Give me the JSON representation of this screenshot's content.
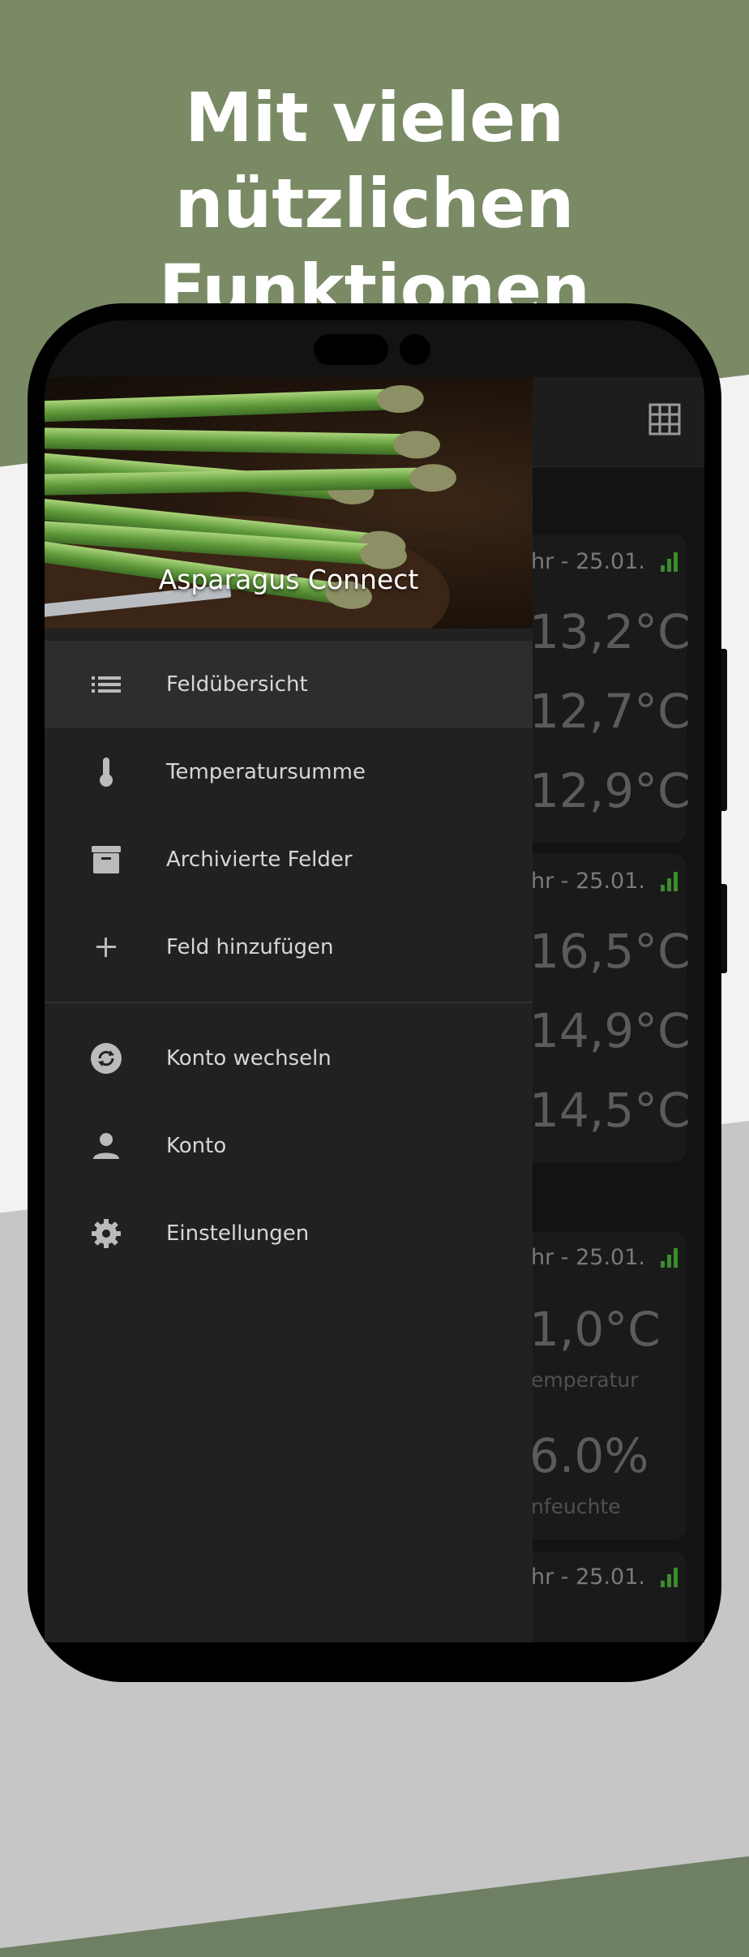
{
  "headline": {
    "line1": "Mit vielen nützlichen",
    "line2": "Funktionen"
  },
  "drawer": {
    "app_name": "Asparagus Connect",
    "items": [
      {
        "label": "Feldübersicht",
        "icon": "list-icon",
        "active": true
      },
      {
        "label": "Temperatursumme",
        "icon": "thermometer-icon"
      },
      {
        "label": "Archivierte Felder",
        "icon": "archive-icon"
      },
      {
        "label": "Feld hinzufügen",
        "icon": "plus-icon"
      },
      {
        "label": "Konto wechseln",
        "icon": "switch-account-icon"
      },
      {
        "label": "Konto",
        "icon": "person-icon"
      },
      {
        "label": "Einstellungen",
        "icon": "gear-icon"
      }
    ]
  },
  "background_app": {
    "toolbar_icon": "grid-icon",
    "cards": [
      {
        "date": "hr - 25.01.",
        "temps": [
          "13,2°C",
          "12,7°C",
          "12,9°C"
        ]
      },
      {
        "date": "hr - 25.01.",
        "temps": [
          "16,5°C",
          "14,9°C",
          "14,5°C"
        ]
      },
      {
        "date": "hr - 25.01.",
        "temp": "1,0°C",
        "temp_label": "emperatur",
        "humidity": "6.0%",
        "humidity_label": "nfeuchte"
      },
      {
        "date": "hr - 25.01."
      }
    ]
  },
  "colors": {
    "background_green": "#7a8a65",
    "signal_green": "#3d8b2f",
    "drawer_bg": "#212121"
  }
}
